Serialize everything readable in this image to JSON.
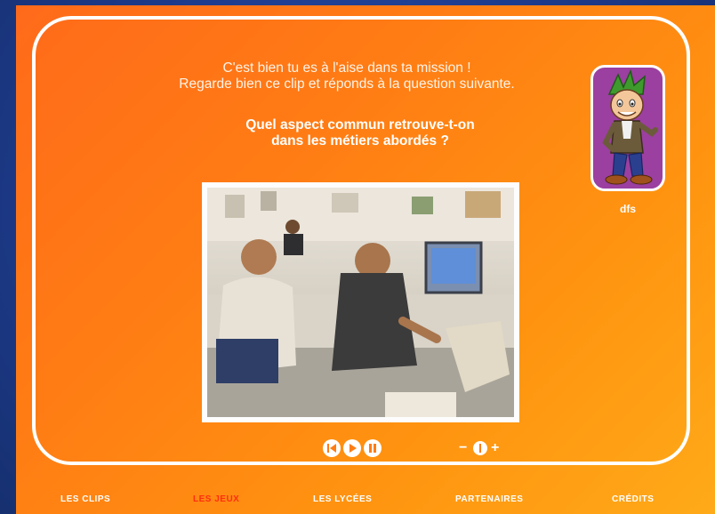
{
  "intro": {
    "line1": "C'est bien tu es à l'aise dans ta mission !",
    "line2": "Regarde bien ce clip et réponds à la question suivante."
  },
  "question": {
    "line1": "Quel aspect commun retrouve-t-on",
    "line2": "dans les métiers abordés ?"
  },
  "avatar": {
    "name": "dfs"
  },
  "video": {
    "description_icon": "office-scene-icon"
  },
  "controls": {
    "rewind_icon": "rewind-icon",
    "play_icon": "play-icon",
    "pause_icon": "pause-icon",
    "volume_minus": "−",
    "volume_plus": "+"
  },
  "nav": {
    "items": [
      {
        "label": "LES CLIPS"
      },
      {
        "label": "LES JEUX"
      },
      {
        "label": "LES LYCÉES"
      },
      {
        "label": "PARTENAIRES"
      },
      {
        "label": "CRÉDITS"
      }
    ]
  },
  "colors": {
    "stage_orange": "#ff7c14",
    "panel_border": "#ffffff",
    "nav_active": "#ff2e10",
    "avatar_bg": "#9b3fa0"
  }
}
